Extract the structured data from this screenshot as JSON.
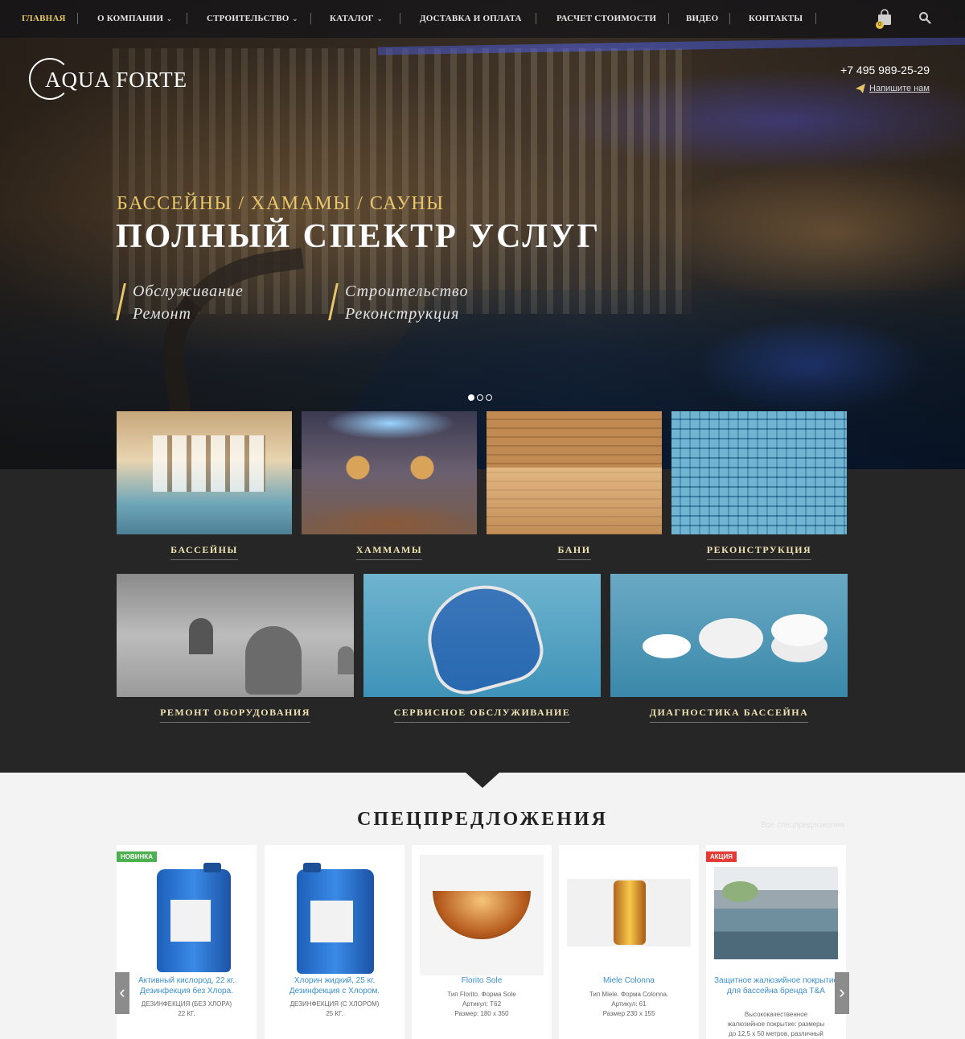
{
  "nav": {
    "items": [
      {
        "label": "ГЛАВНАЯ",
        "active": true,
        "has_submenu": false
      },
      {
        "label": "О КОМПАНИИ",
        "active": false,
        "has_submenu": true
      },
      {
        "label": "СТРОИТЕЛЬСТВО",
        "active": false,
        "has_submenu": true
      },
      {
        "label": "КАТАЛОГ",
        "active": false,
        "has_submenu": true
      },
      {
        "label": "ДОСТАВКА И ОПЛАТА",
        "active": false,
        "has_submenu": false
      },
      {
        "label": "РАСЧЕТ СТОИМОСТИ",
        "active": false,
        "has_submenu": false
      },
      {
        "label": "ВИДЕО",
        "active": false,
        "has_submenu": false
      },
      {
        "label": "КОНТАКТЫ",
        "active": false,
        "has_submenu": false
      }
    ],
    "cart_count": "0",
    "cart_icon": "shopping-bag-icon",
    "search_icon": "search-icon"
  },
  "header": {
    "logo_text": "AQUA FORTE",
    "phone": "+7 495 989-25-29",
    "write_us": "Напишите нам"
  },
  "hero": {
    "subtitle": "БАССЕЙНЫ / ХАМАМЫ / САУНЫ",
    "title": "ПОЛНЫЙ СПЕКТР УСЛУГ",
    "services_left": [
      "Обслуживание",
      "Ремонт"
    ],
    "services_right": [
      "Строительство",
      "Реконструкция"
    ],
    "slides_total": 3,
    "slide_active": 1
  },
  "categories": [
    {
      "label": "БАССЕЙНЫ"
    },
    {
      "label": "ХАММАМЫ"
    },
    {
      "label": "БАНИ"
    },
    {
      "label": "РЕКОНСТРУКЦИЯ"
    }
  ],
  "services": [
    {
      "label": "РЕМОНТ ОБОРУДОВАНИЯ"
    },
    {
      "label": "СЕРВИСНОЕ ОБСЛУЖИВАНИЕ"
    },
    {
      "label": "ДИАГНОСТИКА БАССЕЙНА"
    }
  ],
  "offers": {
    "title": "СПЕЦПРЕДЛОЖЕНИЯ",
    "all_link": "Все спецпредложения",
    "products": [
      {
        "badge": "НОВИНКА",
        "name": "Активный кислород, 22 кг. Дезинфекция без Хлора.",
        "meta": [
          "ДЕЗИНФЕКЦИЯ (БЕЗ ХЛОРА)",
          "22 КГ."
        ]
      },
      {
        "badge": "",
        "name": "Хлорин жидкий, 25 кг. Дезинфекция с Хлором.",
        "meta": [
          "ДЕЗИНФЕКЦИЯ (С ХЛОРОМ)",
          "25 КГ."
        ]
      },
      {
        "badge": "",
        "name": "Florito Sole",
        "meta": [
          "Тип Florito. Форма Sole",
          "Артикул: Т62",
          "Размер: 180 x 350"
        ]
      },
      {
        "badge": "",
        "name": "Miele Colonna",
        "meta": [
          "Тип Miele. Форма Colonna.",
          "Артикул: 61",
          "Размер 230 x 155"
        ]
      },
      {
        "badge": "АКЦИЯ",
        "name": "Защитное жалюзийное покрытие для бассейна бренда T&A",
        "meta": [
          "Высококачественное",
          "жалюзийное покрытие: размеры",
          "до 12,5 x 50 метров, различный"
        ]
      }
    ]
  },
  "colors": {
    "accent_gold": "#e8c66a",
    "dark_bg": "#262626",
    "link_blue": "#3b8fd0",
    "badge_new": "#4caf50",
    "badge_sale": "#e53935"
  }
}
